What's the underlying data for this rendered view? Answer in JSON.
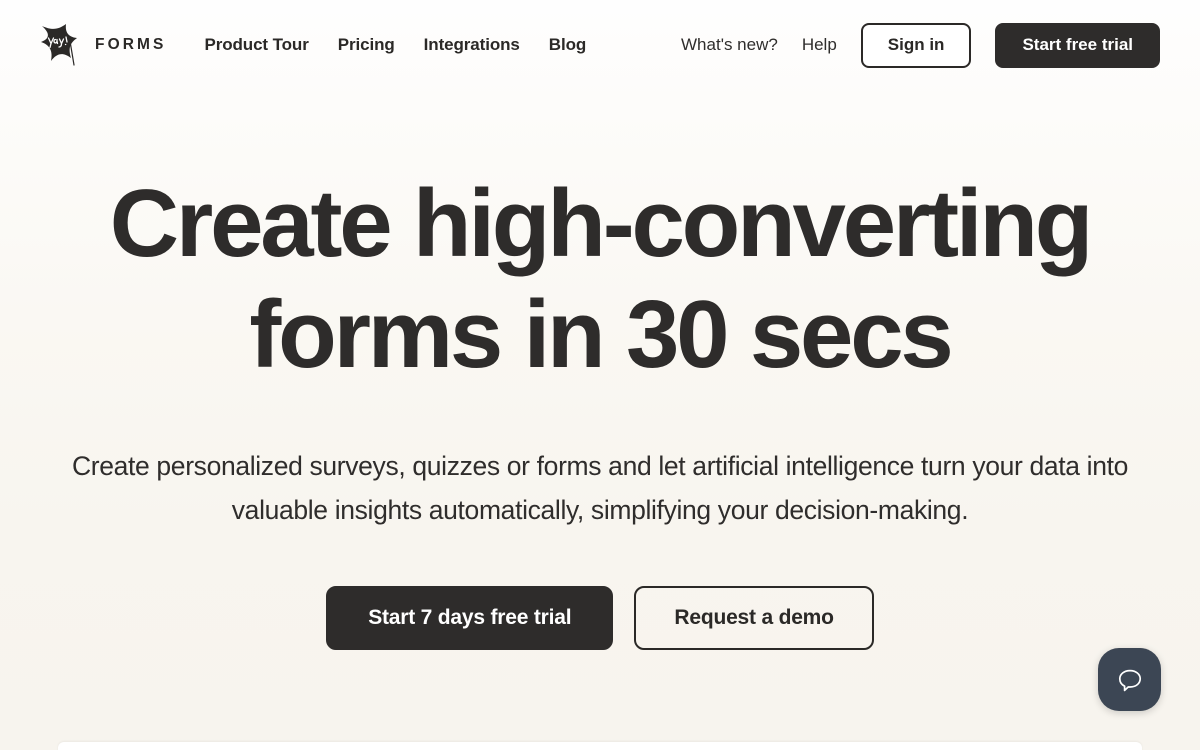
{
  "brand": {
    "logo_icon": "yay-star-logo-icon",
    "logo_script_text": "Yay!",
    "wordmark": "FORMS"
  },
  "header": {
    "nav": [
      {
        "label": "Product Tour"
      },
      {
        "label": "Pricing"
      },
      {
        "label": "Integrations"
      },
      {
        "label": "Blog"
      }
    ],
    "secondary": [
      {
        "label": "What's new?"
      },
      {
        "label": "Help"
      }
    ],
    "sign_in_label": "Sign in",
    "start_trial_label": "Start free trial"
  },
  "hero": {
    "title_line1": "Create high-converting",
    "title_line2": "forms in 30 secs",
    "subtitle_line1": "Create personalized surveys, quizzes or forms and let artificial intelligence turn",
    "subtitle_line2": "your data into valuable insights automatically, simplifying your decision-making.",
    "primary_cta": "Start 7 days free trial",
    "secondary_cta": "Request a demo"
  },
  "chat": {
    "icon": "chat-bubble-icon"
  },
  "colors": {
    "ink": "#2e2c2b",
    "background_top": "#fefefe",
    "background_bottom": "#f7f4ee",
    "chat_bubble_bg": "#3c4654",
    "button_text_on_dark": "#ffffff"
  }
}
